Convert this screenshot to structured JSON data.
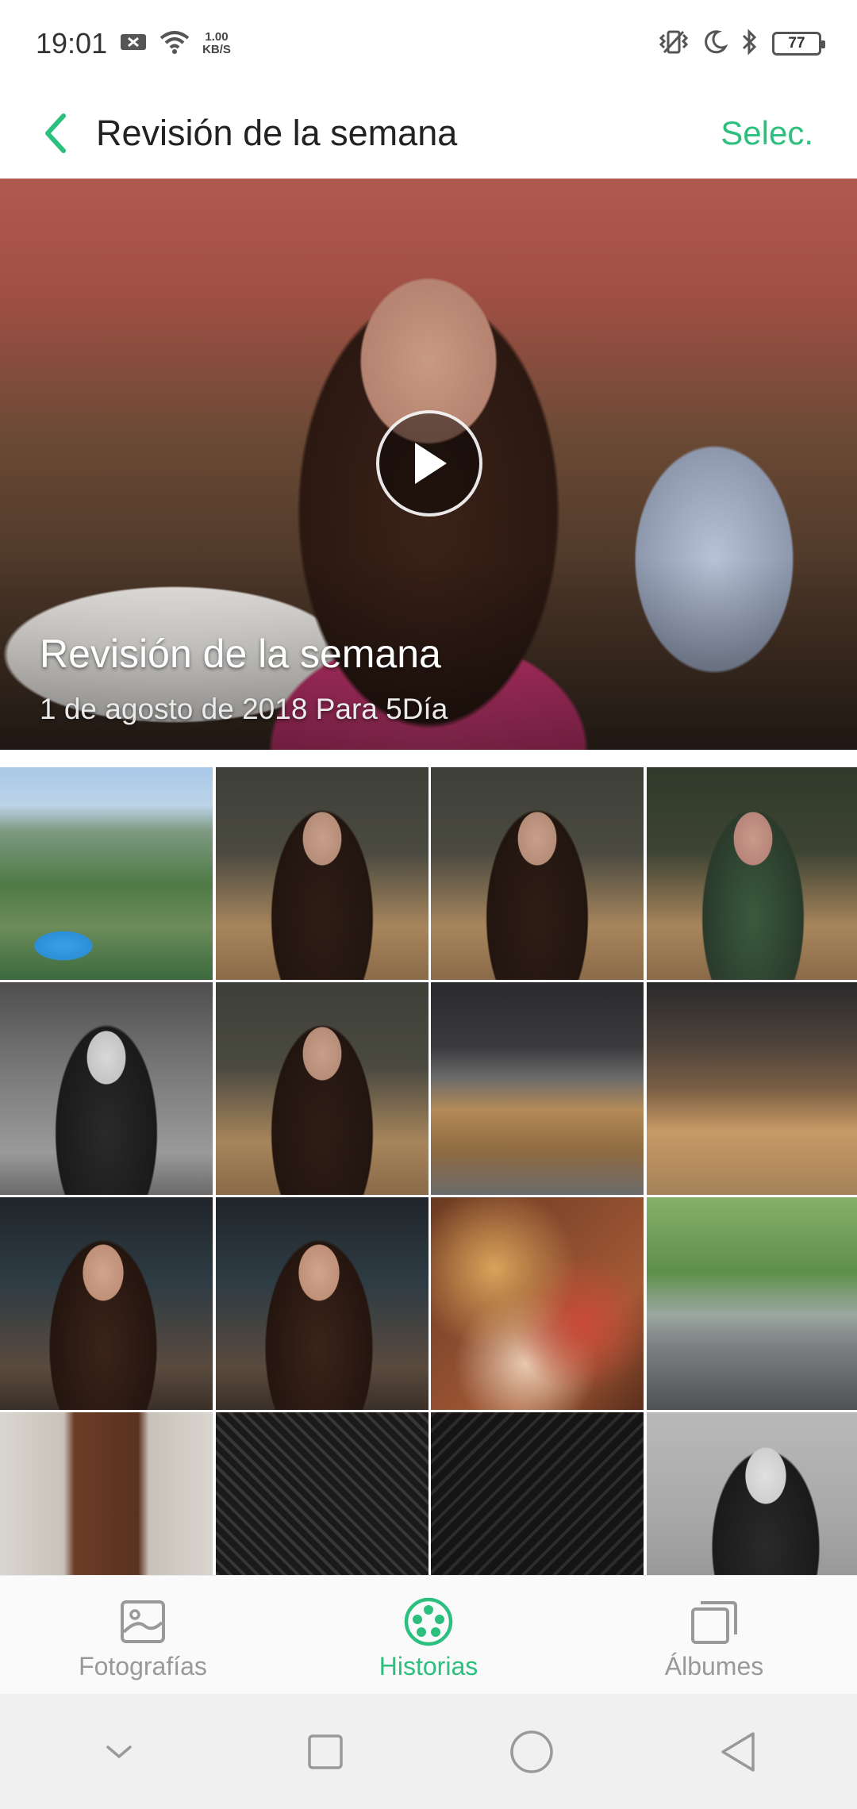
{
  "status_bar": {
    "time": "19:01",
    "net_speed_value": "1.00",
    "net_speed_unit": "KB/S",
    "battery": "77"
  },
  "header": {
    "title": "Revisión de la semana",
    "select_label": "Selec.",
    "accent_color": "#2dbf7e"
  },
  "hero": {
    "title": "Revisión de la semana",
    "subtitle": "1 de agosto de 2018 Para 5Día"
  },
  "grid": {
    "photos": [
      {
        "icon": "aerial-city-photo"
      },
      {
        "icon": "portrait-photo"
      },
      {
        "icon": "portrait-photo"
      },
      {
        "icon": "portrait-tinted-photo"
      },
      {
        "icon": "portrait-bw-photo"
      },
      {
        "icon": "portrait-photo"
      },
      {
        "icon": "restaurant-interior-photo"
      },
      {
        "icon": "restaurant-interior-photo"
      },
      {
        "icon": "portrait-night-photo"
      },
      {
        "icon": "portrait-night-photo"
      },
      {
        "icon": "food-noodles-photo"
      },
      {
        "icon": "street-photo"
      },
      {
        "icon": "wooden-door-photo"
      },
      {
        "icon": "iron-gate-photo"
      },
      {
        "icon": "iron-gate-photo"
      },
      {
        "icon": "portrait-bw-photo"
      }
    ]
  },
  "bottom_nav": {
    "items": [
      {
        "label": "Fotografías",
        "icon": "photo-icon",
        "active": false
      },
      {
        "label": "Historias",
        "icon": "stories-reel-icon",
        "active": true
      },
      {
        "label": "Álbumes",
        "icon": "albums-icon",
        "active": false
      }
    ]
  },
  "system_nav": {
    "buttons": [
      "chevron-down-icon",
      "recents-square-icon",
      "home-circle-icon",
      "back-triangle-icon"
    ]
  }
}
